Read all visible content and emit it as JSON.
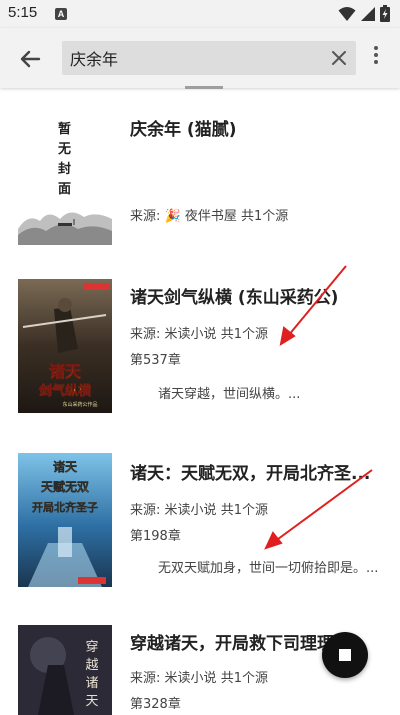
{
  "status_bar": {
    "time": "5:15",
    "notification_glyph": "A",
    "icons": [
      "wifi-icon",
      "signal-icon",
      "battery-charging-icon"
    ]
  },
  "toolbar": {
    "back_icon": "arrow-back-icon",
    "search_value": "庆余年",
    "clear_icon": "close-icon",
    "more_icon": "more-vertical-icon"
  },
  "results": [
    {
      "cover_text": "暂无封面",
      "title": "庆余年 (猫腻)",
      "source_label": "来源:",
      "source_emoji": "🎉",
      "source_name": "夜伴书屋",
      "source_count": "共1个源",
      "chapter": "",
      "intro": ""
    },
    {
      "cover_title": "诸天剑气纵横",
      "cover_badge": "米读小说",
      "cover_sub": "东山采药公作品",
      "title": "诸天剑气纵横 (东山采药公)",
      "source_label": "来源:",
      "source_name": "米读小说",
      "source_count": "共1个源",
      "chapter": "第537章",
      "intro": "诸天穿越，世间纵横。..."
    },
    {
      "cover_title": "诸天天赋无双开局北齐圣子",
      "cover_badge": "起点读书",
      "title": "诸天：天赋无双，开局北齐圣...",
      "source_label": "来源:",
      "source_name": "米读小说",
      "source_count": "共1个源",
      "chapter": "第198章",
      "intro": "无双天赋加身，世间一切俯拾即是。..."
    },
    {
      "cover_title": "穿越诸天",
      "title": "穿越诸天，开局救下司理理 (...",
      "source_label": "来源:",
      "source_name": "米读小说",
      "source_count": "共1个源",
      "chapter": "第328章",
      "intro": ""
    }
  ],
  "fab": {
    "icon": "stop-icon"
  },
  "colors": {
    "toolbar_bg": "#f2f2f2",
    "search_bg": "#dddddd",
    "annotation_arrow": "#e02020",
    "fab_bg": "#111111"
  }
}
